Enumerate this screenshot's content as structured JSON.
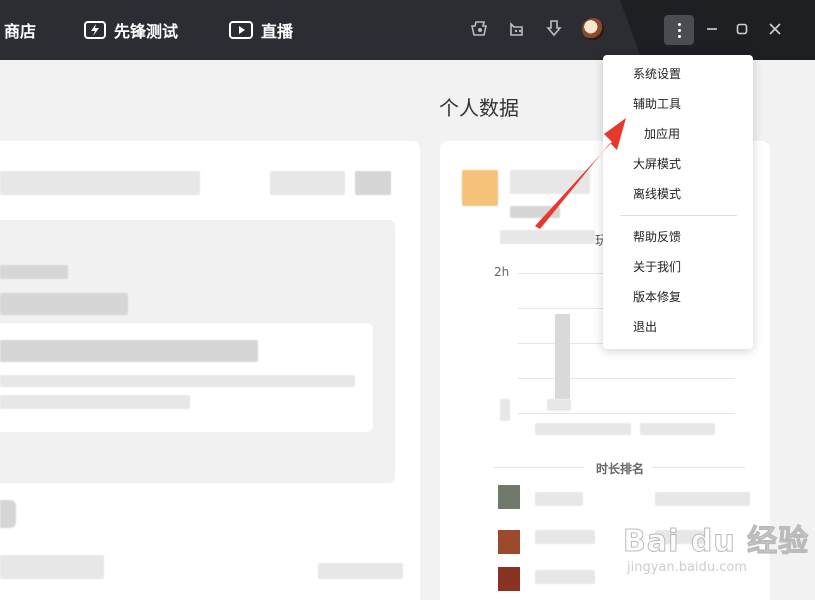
{
  "nav": {
    "items": [
      {
        "label": "商店",
        "icon": "store-icon"
      },
      {
        "label": "先锋测试",
        "icon": "lightning-test-icon"
      },
      {
        "label": "直播",
        "icon": "play-live-icon"
      }
    ]
  },
  "toolbar": {
    "icons": [
      "gamepad-icon",
      "bot-icon",
      "download-icon",
      "user-avatar"
    ],
    "window_controls": [
      "more-menu-icon",
      "minimize-icon",
      "restore-icon",
      "close-icon"
    ]
  },
  "main": {
    "section_title": "个人数据",
    "chart": {
      "y_tick_label": "2h"
    },
    "ranking_title": "时长排名",
    "partial_text": "玩"
  },
  "dropdown_menu": {
    "items": [
      "系统设置",
      "辅助工具",
      "加应用",
      "大屏模式",
      "离线模式"
    ],
    "items_after_separator": [
      "帮助反馈",
      "关于我们",
      "版本修复",
      "退出"
    ],
    "highlighted_item": "辅助工具"
  },
  "annotation": {
    "arrow_color": "#e8382c",
    "target": "辅助工具"
  },
  "watermark": {
    "brand": "Bai du 经验",
    "url": "jingyan.baidu.com"
  },
  "colors": {
    "topbar": "#2b2d33",
    "background": "#f2f2f2",
    "menu_bg": "#ffffff"
  }
}
